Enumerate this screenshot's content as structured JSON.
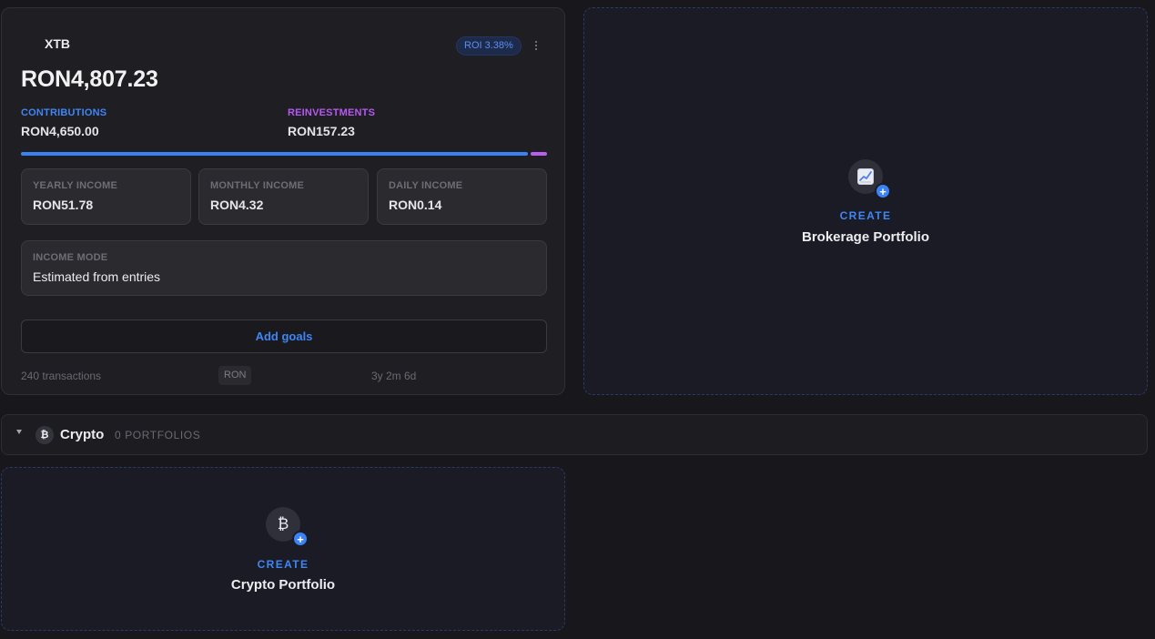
{
  "portfolio": {
    "name": "XTB",
    "roi_badge": "ROI 3.38%",
    "total_value": "RON4,807.23",
    "contributions": {
      "label": "CONTRIBUTIONS",
      "value": "RON4,650.00",
      "color": "#3f86f5"
    },
    "reinvestments": {
      "label": "REINVESTMENTS",
      "value": "RON157.23",
      "color": "#b45af2"
    },
    "split_progress": {
      "contributions_fraction": 0.9673,
      "reinvestments_fraction": 0.0327
    },
    "income": [
      {
        "label": "YEARLY INCOME",
        "value": "RON51.78"
      },
      {
        "label": "MONTHLY INCOME",
        "value": "RON4.32"
      },
      {
        "label": "DAILY INCOME",
        "value": "RON0.14"
      }
    ],
    "income_mode": {
      "label": "INCOME MODE",
      "value": "Estimated from entries"
    },
    "add_goals_label": "Add goals",
    "footer": {
      "transactions": "240 transactions",
      "currency": "RON",
      "duration": "3y 2m 6d"
    }
  },
  "brokerage_create": {
    "icon": "chart-up-icon",
    "create_label": "CREATE",
    "title": "Brokerage Portfolio"
  },
  "crypto_section": {
    "icon": "bitcoin-icon",
    "icon_glyph": "₿",
    "title": "Crypto",
    "count": "0 PORTFOLIOS"
  },
  "crypto_create": {
    "icon": "bitcoin-icon",
    "icon_glyph": "₿",
    "create_label": "CREATE",
    "title": "Crypto Portfolio"
  },
  "colors": {
    "accent": "#3b82f6",
    "reinvest": "#b85ef0",
    "background": "#18171b"
  }
}
